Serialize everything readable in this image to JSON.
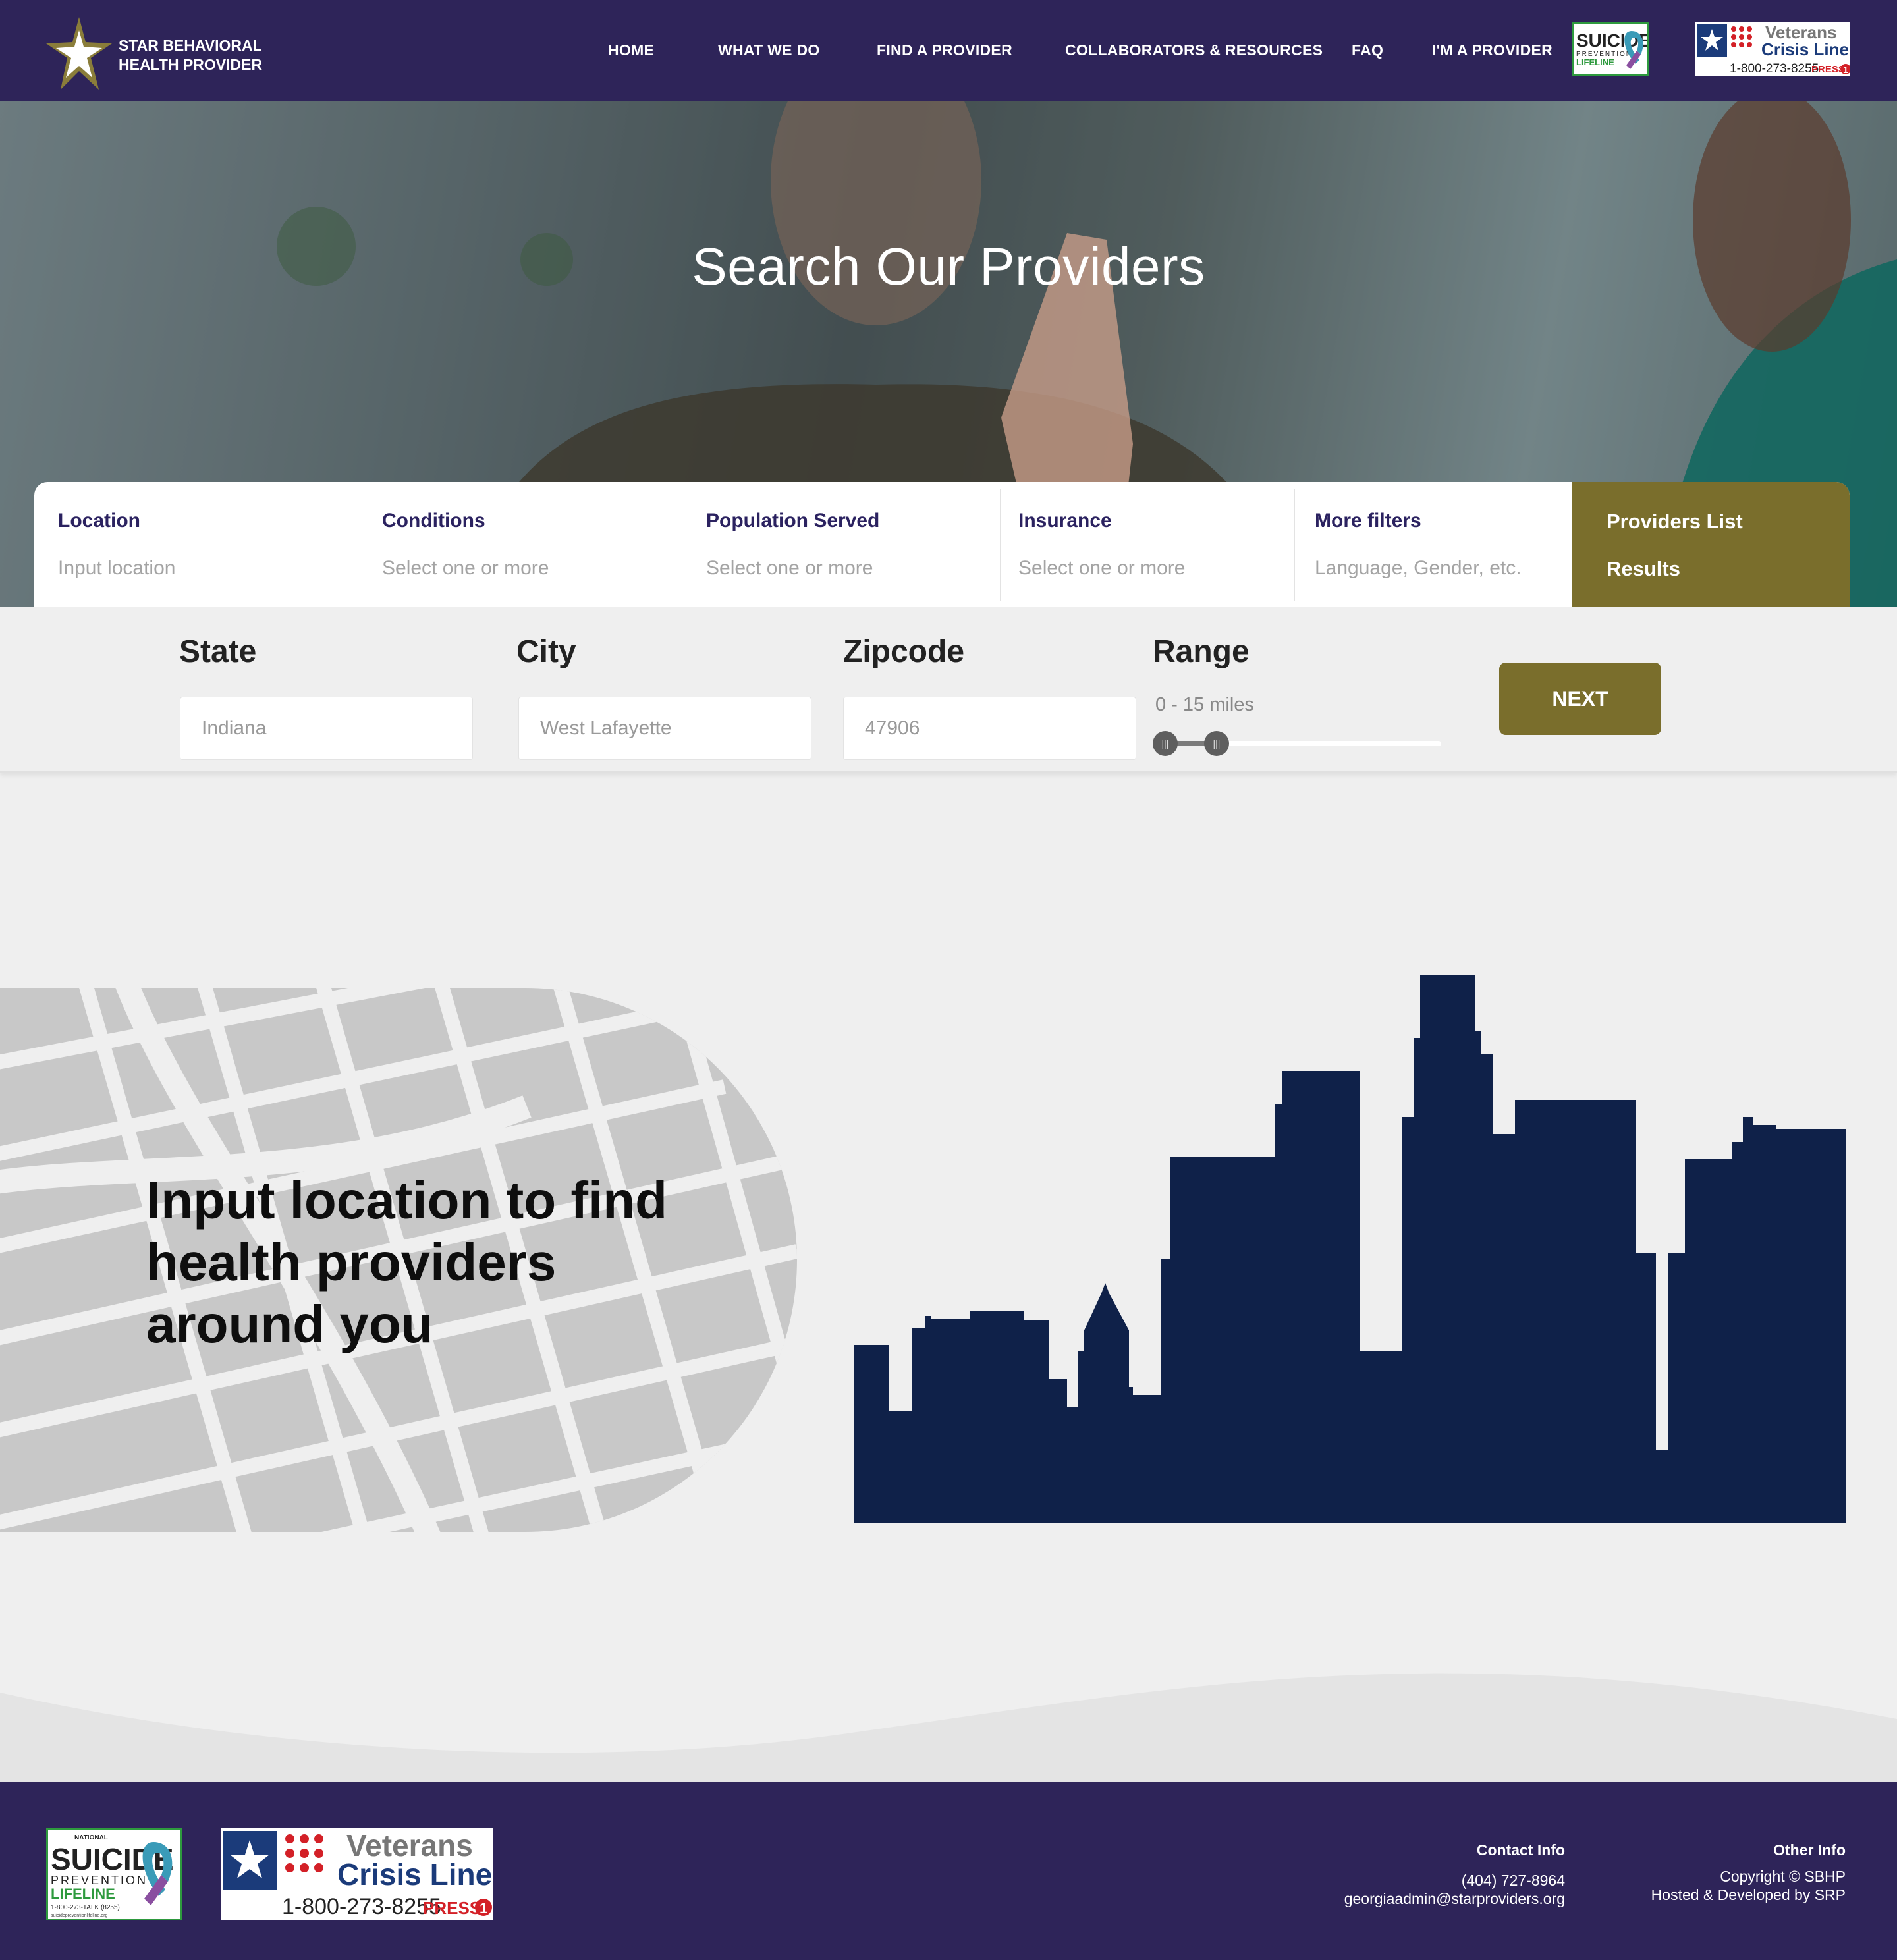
{
  "header": {
    "logo_text_line1": "STAR BEHAVIORAL",
    "logo_text_line2": "HEALTH PROVIDER",
    "nav": [
      {
        "label": "HOME"
      },
      {
        "label": "WHAT WE DO"
      },
      {
        "label": "FIND A PROVIDER"
      },
      {
        "label": "COLLABORATORS & RESOURCES"
      },
      {
        "label": "FAQ"
      },
      {
        "label": "I'M A PROVIDER"
      }
    ]
  },
  "badges": {
    "slp_word": "SUICIDE",
    "slp_sub": "PREVENTION",
    "slp_lifeline": "LIFELINE",
    "slp_national": "NATIONAL",
    "slp_phone": "1-800-273-TALK (8255)",
    "slp_url": "suicidepreventionlifeline.org",
    "vcl_line1": "Veterans",
    "vcl_line2": "Crisis Line",
    "vcl_phone": "1-800-273-8255",
    "vcl_press": "PRESS",
    "vcl_press_num": "1"
  },
  "hero": {
    "title": "Search Our Providers"
  },
  "filters": {
    "location": {
      "label": "Location",
      "placeholder": "Input location"
    },
    "conditions": {
      "label": "Conditions",
      "placeholder": "Select one or more"
    },
    "population": {
      "label": "Population Served",
      "placeholder": "Select one or more"
    },
    "insurance": {
      "label": "Insurance",
      "placeholder": "Select one or more"
    },
    "more": {
      "label": "More filters",
      "placeholder": "Language, Gender, etc."
    },
    "results": {
      "line1": "Providers List",
      "line2": "Results"
    }
  },
  "location_form": {
    "state_label": "State",
    "state_value": "Indiana",
    "city_label": "City",
    "city_value": "West Lafayette",
    "zip_label": "Zipcode",
    "zip_value": "47906",
    "range_label": "Range",
    "range_value": "0 - 15 miles",
    "range_min": 0,
    "range_max": 15,
    "next_label": "NEXT"
  },
  "main": {
    "map_message": "Input location to find health providers around you"
  },
  "footer": {
    "contact_title": "Contact Info",
    "contact_phone": "(404) 727-8964",
    "contact_email": "georgiaadmin@starproviders.org",
    "other_title": "Other Info",
    "other_line1": "Copyright © SBHP",
    "other_line2": "Hosted & Developed by SRP"
  },
  "colors": {
    "brand_purple": "#2e2459",
    "accent_olive": "#7a6e2c",
    "skyline_navy": "#0f2149",
    "label_purple": "#2b2260"
  }
}
